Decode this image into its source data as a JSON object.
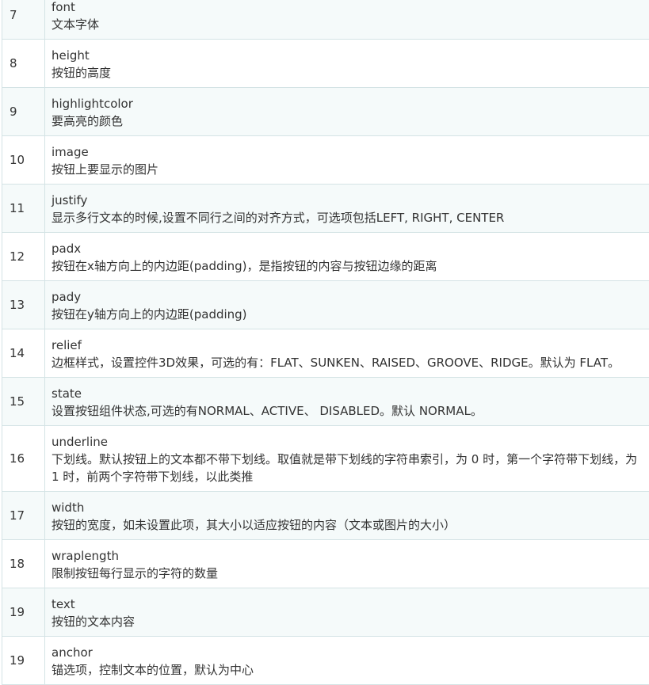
{
  "rows": [
    {
      "num": "7",
      "param": "font",
      "desc": "文本字体"
    },
    {
      "num": "8",
      "param": "height",
      "desc": "按钮的高度"
    },
    {
      "num": "9",
      "param": "highlightcolor",
      "desc": "要高亮的颜色"
    },
    {
      "num": "10",
      "param": "image",
      "desc": "按钮上要显示的图片"
    },
    {
      "num": "11",
      "param": "justify",
      "desc": "显示多行文本的时候,设置不同行之间的对齐方式，可选项包括LEFT, RIGHT, CENTER"
    },
    {
      "num": "12",
      "param": "padx",
      "desc": "按钮在x轴方向上的内边距(padding)，是指按钮的内容与按钮边缘的距离"
    },
    {
      "num": "13",
      "param": "pady",
      "desc": "按钮在y轴方向上的内边距(padding)"
    },
    {
      "num": "14",
      "param": "relief",
      "desc": "边框样式，设置控件3D效果，可选的有：FLAT、SUNKEN、RAISED、GROOVE、RIDGE。默认为 FLAT。"
    },
    {
      "num": "15",
      "param": "state",
      "desc": "设置按钮组件状态,可选的有NORMAL、ACTIVE、 DISABLED。默认 NORMAL。"
    },
    {
      "num": "16",
      "param": "underline",
      "desc": "下划线。默认按钮上的文本都不带下划线。取值就是带下划线的字符串索引，为 0 时，第一个字符带下划线，为 1 时，前两个字符带下划线，以此类推"
    },
    {
      "num": "17",
      "param": "width",
      "desc": "按钮的宽度，如未设置此项，其大小以适应按钮的内容（文本或图片的大小）"
    },
    {
      "num": "18",
      "param": "wraplength",
      "desc": "限制按钮每行显示的字符的数量"
    },
    {
      "num": "19",
      "param": "text",
      "desc": "按钮的文本内容"
    },
    {
      "num": "19",
      "param": "anchor",
      "desc": "锚选项，控制文本的位置，默认为中心"
    }
  ]
}
